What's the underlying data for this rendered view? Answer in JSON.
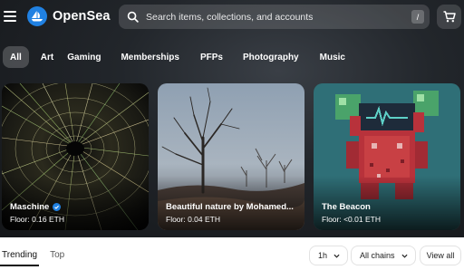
{
  "header": {
    "brand": "OpenSea",
    "search_placeholder": "Search items, collections, and accounts",
    "search_shortcut": "/"
  },
  "categories": [
    "All",
    "Art",
    "Gaming",
    "Memberships",
    "PFPs",
    "Photography",
    "Music"
  ],
  "active_category": "All",
  "cards": [
    {
      "title": "Maschine",
      "floor": "Floor: 0.16 ETH",
      "verified": true
    },
    {
      "title": "Beautiful nature by Mohamed...",
      "floor": "Floor: 0.04 ETH",
      "verified": false
    },
    {
      "title": "The Beacon",
      "floor": "Floor: <0.01 ETH",
      "verified": false
    }
  ],
  "tabs": [
    "Trending",
    "Top"
  ],
  "active_tab": "Trending",
  "controls": {
    "time_range": "1h",
    "chain": "All chains",
    "view_all": "View all"
  },
  "colors": {
    "brand": "#2081e2",
    "hero_bg": "#1c1f23",
    "beacon_bg": "#2f6f77"
  }
}
